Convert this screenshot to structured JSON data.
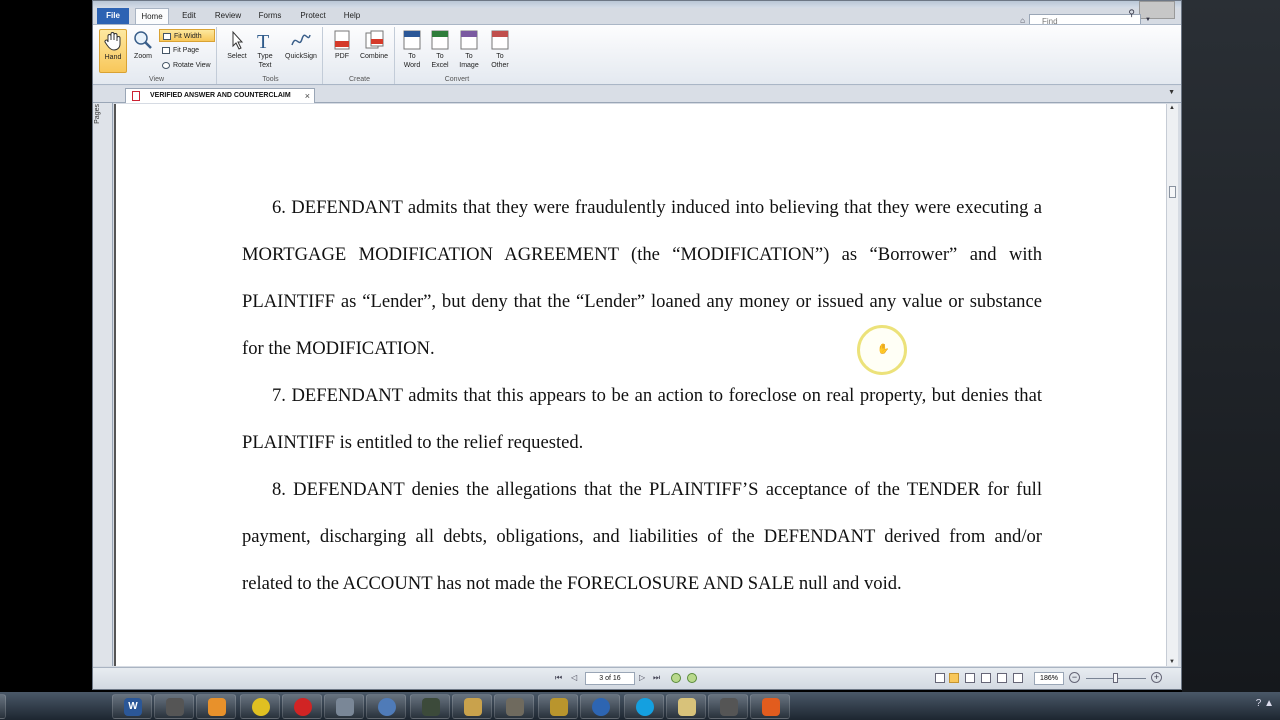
{
  "ribbon": {
    "tabs": [
      "File",
      "Home",
      "Edit",
      "Review",
      "Forms",
      "Protect",
      "Help"
    ],
    "find_placeholder": "Find",
    "view": {
      "label": "View",
      "hand": "Hand",
      "zoom": "Zoom",
      "fit_width": "Fit Width",
      "fit_page": "Fit Page",
      "rotate_view": "Rotate View"
    },
    "tools": {
      "label": "Tools",
      "select": "Select",
      "type_text_1": "Type",
      "type_text_2": "Text",
      "quicksign": "QuickSign"
    },
    "create": {
      "label": "Create",
      "pdf": "PDF",
      "combine": "Combine"
    },
    "convert": {
      "label": "Convert",
      "to_word_1": "To",
      "to_word_2": "Word",
      "to_excel_1": "To",
      "to_excel_2": "Excel",
      "to_image_1": "To",
      "to_image_2": "Image",
      "to_other_1": "To",
      "to_other_2": "Other"
    }
  },
  "document_tab": {
    "title": "VERIFIED ANSWER AND COUNTERCLAIM"
  },
  "side_panel": {
    "label": "Pages"
  },
  "document": {
    "paragraphs": [
      "6.  DEFENDANT admits that they were fraudulently induced into believing that they were executing a MORTGAGE MODIFICATION AGREEMENT (the “MODIFICATION”) as “Borrower” and with PLAINTIFF as “Lender”, but deny that the “Lender” loaned any money or issued any value or substance for the MODIFICATION.",
      "7.  DEFENDANT admits that this appears to be an action to foreclose on real property, but denies that PLAINTIFF is entitled to the relief requested.",
      "8.  DEFENDANT denies the allegations that the PLAINTIFF’S acceptance of the TENDER for full payment, discharging all debts, obligations, and liabilities of the DEFENDANT derived from and/or related to the ACCOUNT has not made the FORECLOSURE AND SALE null and void."
    ]
  },
  "statusbar": {
    "page_indicator": "3 of 16",
    "zoom": "186%"
  },
  "colors": {
    "file_tab": "#2d63b3",
    "selected_button": "#f8c75a",
    "cursor_ring": "#ece27a"
  }
}
